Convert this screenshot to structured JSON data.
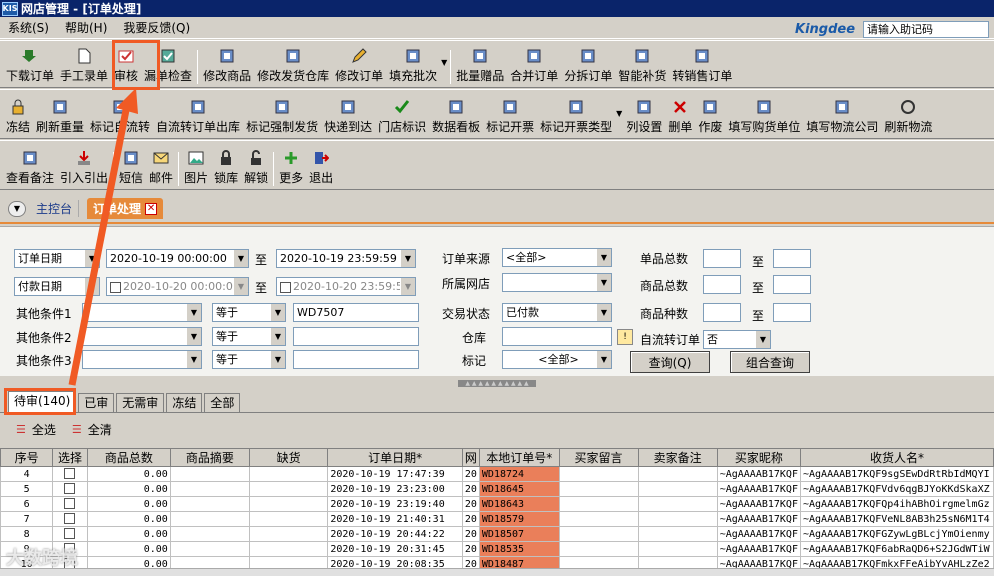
{
  "title": "网店管理 - [订单处理]",
  "title_icon": "KIS",
  "menu": [
    "系统(S)",
    "帮助(H)",
    "我要反馈(Q)"
  ],
  "brand": {
    "logo": "Kingdee",
    "assist_placeholder": "请输入助记码"
  },
  "toolbar1": [
    {
      "name": "download-orders",
      "label": "下载订单",
      "icon": "download-icon"
    },
    {
      "name": "manual-order",
      "label": "手工录单",
      "icon": "document-icon"
    },
    {
      "name": "audit",
      "label": "审核",
      "icon": "audit-icon"
    },
    {
      "name": "check-order",
      "label": "漏单检查",
      "icon": "check-icon"
    },
    {
      "name": "modify-goods",
      "label": "修改商品",
      "icon": "edit-goods-icon"
    },
    {
      "name": "modify-warehouse",
      "label": "修改发货仓库",
      "icon": "warehouse-icon"
    },
    {
      "name": "modify-order",
      "label": "修改订单",
      "icon": "pencil-icon"
    },
    {
      "name": "fill-batch",
      "label": "填充批次",
      "icon": "batch-icon"
    },
    {
      "name": "batch-gift",
      "label": "批量赠品",
      "icon": "gift-icon"
    },
    {
      "name": "merge-order",
      "label": "合并订单",
      "icon": "merge-icon"
    },
    {
      "name": "split-order",
      "label": "分拆订单",
      "icon": "split-icon"
    },
    {
      "name": "smart-restock",
      "label": "智能补货",
      "icon": "restock-icon"
    },
    {
      "name": "transfer-order",
      "label": "转销售订单",
      "icon": "transfer-icon"
    }
  ],
  "toolbar2": [
    {
      "name": "freeze",
      "label": "冻结",
      "icon": "lock-icon"
    },
    {
      "name": "refresh-weight",
      "label": "刷新重量",
      "icon": "monitor-icon"
    },
    {
      "name": "mark-self-flow",
      "label": "标记自流转",
      "icon": "flow-icon"
    },
    {
      "name": "self-flow-out",
      "label": "自流转订单出库",
      "icon": "outbound-icon"
    },
    {
      "name": "force-ship",
      "label": "标记强制发货",
      "icon": "flag-icon"
    },
    {
      "name": "express-arrive",
      "label": "快递到达",
      "icon": "express-icon"
    },
    {
      "name": "store-mark",
      "label": "门店标识",
      "icon": "checkmark-icon"
    },
    {
      "name": "dashboard",
      "label": "数据看板",
      "icon": "dashboard-icon"
    },
    {
      "name": "mark-invoice",
      "label": "标记开票",
      "icon": "invoice-icon"
    },
    {
      "name": "invoice-type",
      "label": "标记开票类型",
      "icon": "invoice-type-icon"
    },
    {
      "name": "column-settings",
      "label": "列设置",
      "icon": "columns-icon"
    },
    {
      "name": "delete-order",
      "label": "删单",
      "icon": "cross-icon"
    },
    {
      "name": "void",
      "label": "作废",
      "icon": "trash-icon"
    },
    {
      "name": "fill-buyer-unit",
      "label": "填写购货单位",
      "icon": "buyer-icon"
    },
    {
      "name": "fill-logistics",
      "label": "填写物流公司",
      "icon": "logistics-icon"
    },
    {
      "name": "refresh-logistics",
      "label": "刷新物流",
      "icon": "refresh-icon"
    }
  ],
  "toolbar3": [
    {
      "name": "view-remark",
      "label": "查看备注",
      "icon": "note-icon"
    },
    {
      "name": "import-export",
      "label": "引入引出",
      "icon": "import-icon"
    },
    {
      "name": "sms",
      "label": "短信",
      "icon": "phone-icon"
    },
    {
      "name": "mail",
      "label": "邮件",
      "icon": "mail-icon"
    },
    {
      "name": "picture",
      "label": "图片",
      "icon": "picture-icon"
    },
    {
      "name": "lock-stock",
      "label": "锁库",
      "icon": "padlock-icon"
    },
    {
      "name": "unlock",
      "label": "解锁",
      "icon": "unlock-icon"
    },
    {
      "name": "more",
      "label": "更多",
      "icon": "plus-icon"
    },
    {
      "name": "exit",
      "label": "退出",
      "icon": "exit-icon"
    }
  ],
  "tabs": {
    "home": "主控台",
    "active": "订单处理"
  },
  "filters": {
    "date1_field": "订单日期",
    "date1_from": "2020-10-19 00:00:00",
    "date1_to": "2020-10-19 23:59:59",
    "date2_field": "付款日期",
    "date2_from": "2020-10-20 00:00:0",
    "date2_to": "2020-10-20 23:59:5",
    "to": "至",
    "cond1": "其他条件1",
    "cond2": "其他条件2",
    "cond3": "其他条件3",
    "op": "等于",
    "cond1_value": "WD7507",
    "source_label": "订单来源",
    "source_value": "<全部>",
    "shop_label": "所属网店",
    "shop_value": "",
    "status_label": "交易状态",
    "status_value": "已付款",
    "warehouse_label": "仓库",
    "mark_label": "标记",
    "mark_value": "<全部>",
    "single_total": "单品总数",
    "goods_total": "商品总数",
    "goods_kinds": "商品种数",
    "self_flow_label": "自流转订单",
    "self_flow_value": "否",
    "query_btn": "查询(Q)",
    "combo_btn": "组合查询"
  },
  "subtabs": [
    "待审(140)",
    "已审",
    "无需审",
    "冻结",
    "全部"
  ],
  "select_all": "全选",
  "clear_all": "全清",
  "columns": [
    "序号",
    "选择",
    "商品总数",
    "商品摘要",
    "缺货",
    "订单日期*",
    "网",
    "本地订单号*",
    "买家留言",
    "卖家备注",
    "买家昵称",
    "收货人名*"
  ],
  "rows": [
    {
      "no": "4",
      "qty": "0.00",
      "date": "2020-10-19",
      "time": "17:47:39",
      "net": "20",
      "order": "WD18724",
      "nick": "~AgAAAAB17KQF",
      "recv": "~AgAAAAB17KQF9sgSEwDdRtRbIdMQYI"
    },
    {
      "no": "5",
      "qty": "0.00",
      "date": "2020-10-19",
      "time": "23:23:00",
      "net": "20",
      "order": "WD18645",
      "nick": "~AgAAAAB17KQF",
      "recv": "~AgAAAAB17KQFVdv6qgBJYoKKdSkaXZ"
    },
    {
      "no": "6",
      "qty": "0.00",
      "date": "2020-10-19",
      "time": "23:19:40",
      "net": "20",
      "order": "WD18643",
      "nick": "~AgAAAAB17KQF",
      "recv": "~AgAAAAB17KQFQp4ihABhOirgmelmGz"
    },
    {
      "no": "7",
      "qty": "0.00",
      "date": "2020-10-19",
      "time": "21:40:31",
      "net": "20",
      "order": "WD18579",
      "nick": "~AgAAAAB17KQF",
      "recv": "~AgAAAAB17KQFVeNL8AB3h25sN6M1T4"
    },
    {
      "no": "8",
      "qty": "0.00",
      "date": "2020-10-19",
      "time": "20:44:22",
      "net": "20",
      "order": "WD18507",
      "nick": "~AgAAAAB17KQF",
      "recv": "~AgAAAAB17KQFGZywLgBLcjYmOienmy"
    },
    {
      "no": "9",
      "qty": "0.00",
      "date": "2020-10-19",
      "time": "20:31:45",
      "net": "20",
      "order": "WD18535",
      "nick": "~AgAAAAB17KQF",
      "recv": "~AgAAAAB17KQF6abRaQD6+S2JGdWTiW"
    },
    {
      "no": "10",
      "qty": "0.00",
      "date": "2020-10-19",
      "time": "20:08:35",
      "net": "20",
      "order": "WD18487",
      "nick": "~AgAAAAB17KQF",
      "recv": "~AgAAAAB17KQFmkxFFeAibYvAHLzZe2"
    }
  ],
  "watermark": "大数跨境",
  "colors": {
    "title_bg": "#0a246a",
    "highlight": "#f05a24",
    "order_cell": "#ea7f5a",
    "tab_accent": "#e68a3a"
  }
}
